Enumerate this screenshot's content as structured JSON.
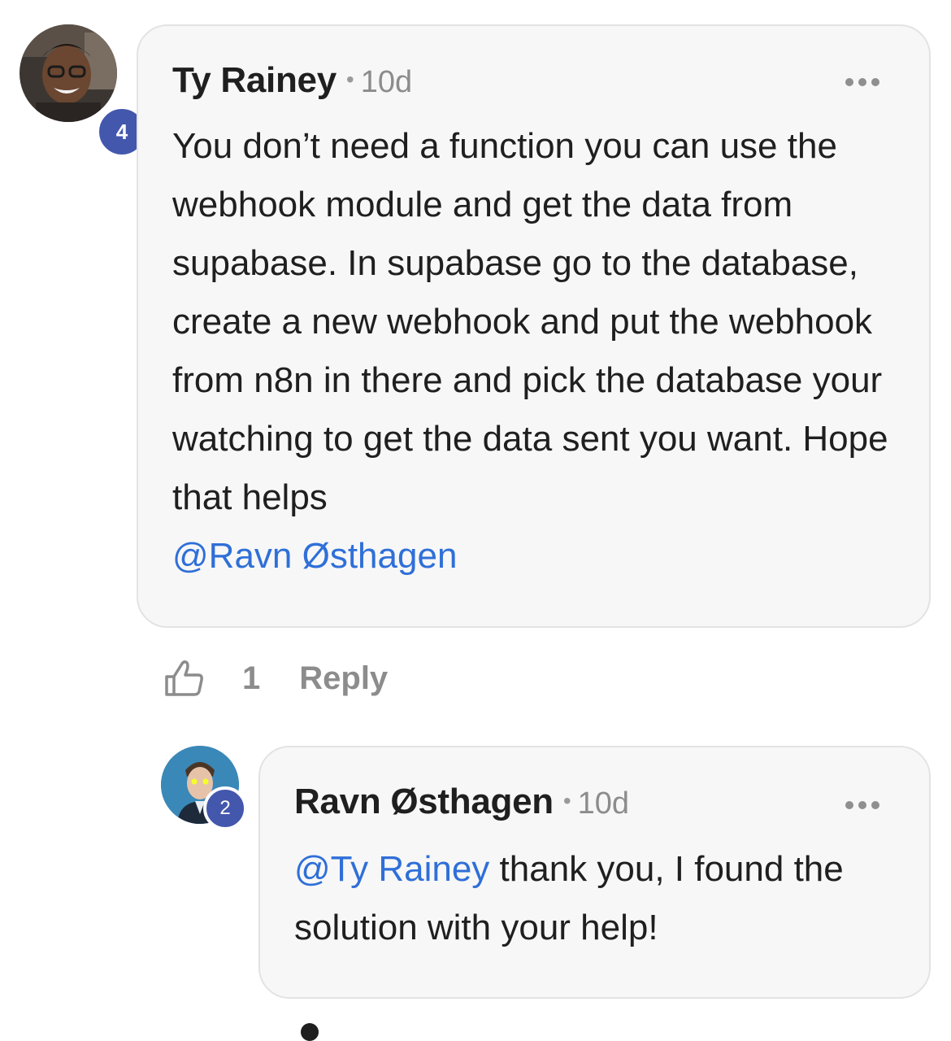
{
  "comments": [
    {
      "author": "Ty Rainey",
      "timestamp": "10d",
      "level": "4",
      "body_text": "You don’t need a function you can use the webhook module and get the data from supabase. In supabase go to the database, create a new webhook and put the webhook from n8n in there and pick the database your watching to get the data sent you want. Hope that helps",
      "mention": "@Ravn Østhagen",
      "likes": "1",
      "reply_label": "Reply",
      "avatar_icon": "user-photo-avatar"
    },
    {
      "author": "Ravn Østhagen",
      "timestamp": "10d",
      "level": "2",
      "mention": "@Ty Rainey",
      "body_text": " thank you, I found the solution with your help!",
      "avatar_icon": "user-photo-avatar"
    }
  ],
  "icons": {
    "more": "more-horizontal-icon",
    "like": "thumbs-up-icon"
  },
  "colors": {
    "mention": "#2f6fd8",
    "badge": "#4357ad",
    "bubble_bg": "#f7f7f7",
    "muted_text": "#8c8c8c"
  }
}
